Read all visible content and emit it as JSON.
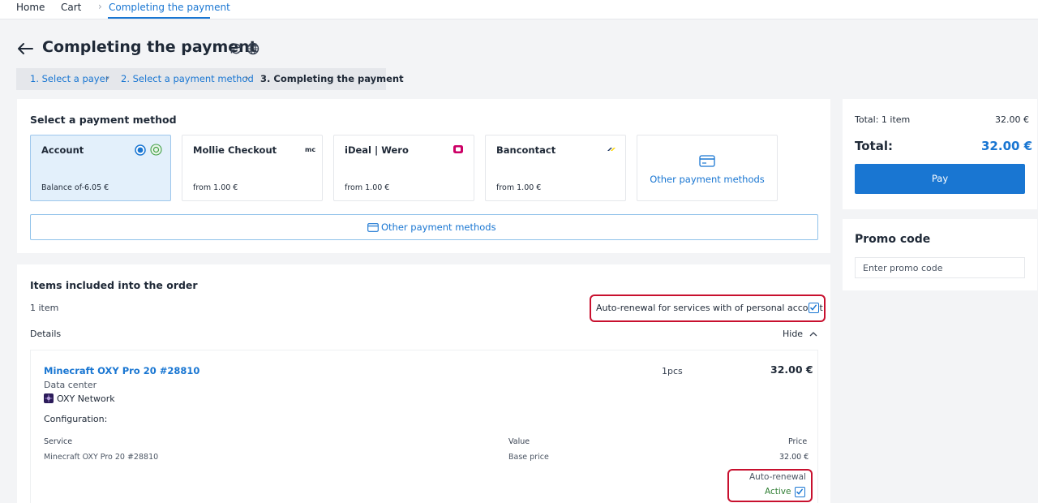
{
  "breadcrumb": {
    "home": "Home",
    "cart": "Cart",
    "current": "Completing the payment"
  },
  "page": {
    "title": "Completing the payment"
  },
  "steps": [
    {
      "label": "1. Select a payer"
    },
    {
      "label": "2. Select a payment method"
    },
    {
      "label": "3. Completing the payment"
    }
  ],
  "payment": {
    "section_title": "Select a payment method",
    "methods": [
      {
        "name": "Account",
        "sub": "Balance of-6.05 €"
      },
      {
        "name": "Mollie Checkout",
        "sub": "from 1.00 €",
        "logo": "mc"
      },
      {
        "name": "iDeal | Wero",
        "sub": "from 1.00 €"
      },
      {
        "name": "Bancontact",
        "sub": "from 1.00 €"
      }
    ],
    "other_card_label": "Other payment methods",
    "other_button_label": "Other payment methods"
  },
  "order": {
    "section_title": "Items included into the order",
    "count": "1 item",
    "auto_renewal_label": "Auto-renewal for services with of personal account",
    "details_label": "Details",
    "hide_label": "Hide",
    "item": {
      "name": "Minecraft OXY Pro 20 #28810",
      "quantity": "1pcs",
      "price": "32.00 €",
      "dc_label": "Data center",
      "dc_name": "OXY Network",
      "config_label": "Configuration:",
      "table": {
        "headers": [
          "Service",
          "Value",
          "Price"
        ],
        "row": [
          "Minecraft OXY Pro 20 #28810",
          "Base price",
          "32.00 €"
        ]
      },
      "auto_renewal_title": "Auto-renewal",
      "auto_renewal_status": "Active"
    }
  },
  "summary": {
    "total_items_label": "Total: 1 item",
    "total_items_value": "32.00 €",
    "total_label": "Total:",
    "total_value": "32.00 €",
    "pay_label": "Pay"
  },
  "promo": {
    "title": "Promo code",
    "placeholder": "Enter promo code"
  },
  "colors": {
    "accent": "#1976d2",
    "highlight": "#c8102e",
    "active_green": "#2e7d32"
  }
}
